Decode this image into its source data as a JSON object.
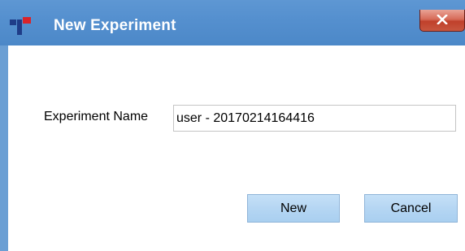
{
  "window": {
    "title": "New Experiment",
    "icons": {
      "app": "tecan-logo-icon",
      "close": "close-icon"
    },
    "close_label": "x"
  },
  "form": {
    "experiment_name_label": "Experiment Name",
    "experiment_name_value": "user - 20170214164416"
  },
  "buttons": {
    "new_label": "New",
    "cancel_label": "Cancel"
  },
  "colors": {
    "titlebar": "#5590cf",
    "close_button": "#c94e38",
    "button_fill": "#b5d6f3",
    "logo_blue": "#1f3c88",
    "logo_red": "#d9232a"
  }
}
